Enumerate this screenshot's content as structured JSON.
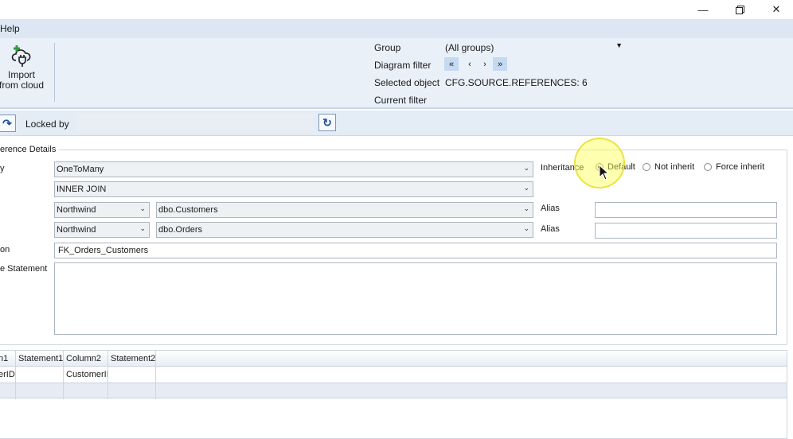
{
  "window": {
    "minimize_icon": "minimize-icon",
    "restore_icon": "restore-icon",
    "close_icon": "close-icon"
  },
  "menu": {
    "help": "Help"
  },
  "ribbon": {
    "import_label_1": "Import",
    "import_label_2": "from cloud",
    "group_label": "Group",
    "group_value": "(All groups)",
    "diagram_filter_label": "Diagram filter",
    "selected_object_label": "Selected object",
    "selected_object_value": "CFG.SOURCE.REFERENCES: 6",
    "current_filter_label": "Current filter",
    "nav": [
      "«",
      "‹",
      "›",
      "»"
    ]
  },
  "toolbar": {
    "locked_by_label": "Locked by",
    "locked_by_value": ""
  },
  "details": {
    "legend": "erence Details",
    "label_cardinality": "y",
    "cardinality_value": "OneToMany",
    "join_value": "INNER JOIN",
    "source_db": "Northwind",
    "source_table": "dbo.Customers",
    "target_db": "Northwind",
    "target_table": "dbo.Orders",
    "alias_label_1": "Alias",
    "alias_label_2": "Alias",
    "alias_value_1": "",
    "alias_value_2": "",
    "label_description": "on",
    "description_value": "FK_Orders_Customers",
    "label_statement": "e Statement",
    "statement_value": "",
    "inheritance_label": "Inheritance",
    "radio_default": "Default",
    "radio_not_inherit": "Not inherit",
    "radio_force_inherit": "Force inherit",
    "selected_radio": "Default"
  },
  "grid": {
    "headers": [
      "n1",
      "Statement1",
      "Column2",
      "Statement2"
    ],
    "rows": [
      [
        "erID",
        "",
        "CustomerID",
        ""
      ]
    ]
  }
}
